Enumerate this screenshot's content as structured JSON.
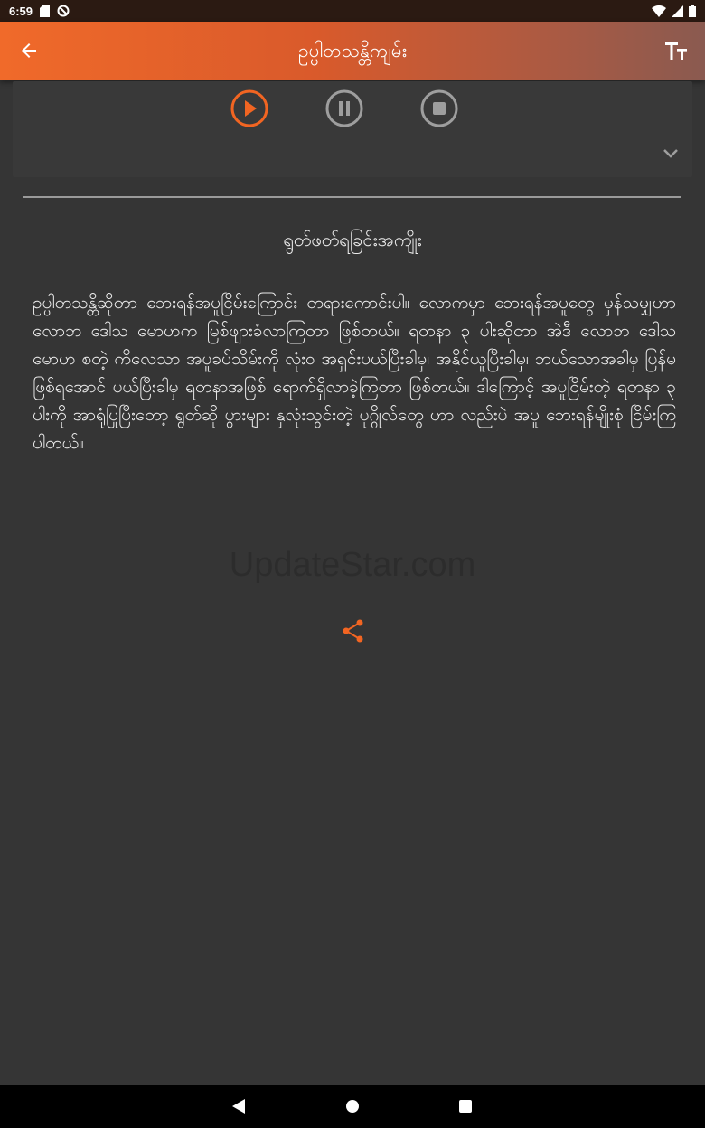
{
  "status_bar": {
    "time": "6:59",
    "icons": [
      "sd-card-icon",
      "do-not-disturb-icon",
      "wifi-icon",
      "signal-icon",
      "battery-icon"
    ]
  },
  "app_bar": {
    "title": "ဥပ္ပါတသန္တိကျမ်း",
    "back_icon": "arrow-back-icon",
    "text_size_icon": "text-size-icon"
  },
  "player": {
    "buttons": [
      "play-icon",
      "pause-icon",
      "stop-icon"
    ],
    "accent_color": "#f26522",
    "inactive_color": "#9e9e9e"
  },
  "content": {
    "title": "ရွတ်ဖတ်ရခြင်းအကျိုး",
    "body": "ဥပ္ပါတသန္တိဆိုတာ ဘေးရန်အပူငြိမ်းကြောင်း တရားကောင်းပါ။ လောကမှာ ဘေးရန်အပူတွေ မှန်သမျှဟာ လောဘ ဒေါသ မောဟက မြစ်ဖျားခံလာကြတာ ဖြစ်တယ်။ ရတနာ ၃ ပါးဆိုတာ အဲဒီ လောဘ ဒေါသ မောဟ စတဲ့ ကိလေသာ အပူခပ်သိမ်းကို လုံး၀ အရှင်းပယ်ပြီးခါမှ၊ အနိုင်ယူပြီးခါမှ၊ ဘယ်သောအခါမှ ပြန်မဖြစ်ရအောင် ပယ်ပြီးခါမှ ရတနာအဖြစ် ရောက်ရှိလာခဲ့ကြတာ ဖြစ်တယ်။ ဒါကြောင့် အပူငြိမ်းတဲ့ ရတနာ ၃ ပါးကို အာရုံပြုပြီးတော့ ရွတ်ဆို ပွားများ နှလုံးသွင်းတဲ့ ပုဂ္ဂိုလ်တွေ ဟာ လည်းပဲ အပူ ဘေးရန်မျိုးစုံ ငြိမ်းကြပါတယ်။",
    "watermark": "UpdateStar.com",
    "share_icon": "share-icon"
  },
  "nav_bar": {
    "buttons": [
      "back-triangle-icon",
      "home-circle-icon",
      "recents-square-icon"
    ]
  }
}
